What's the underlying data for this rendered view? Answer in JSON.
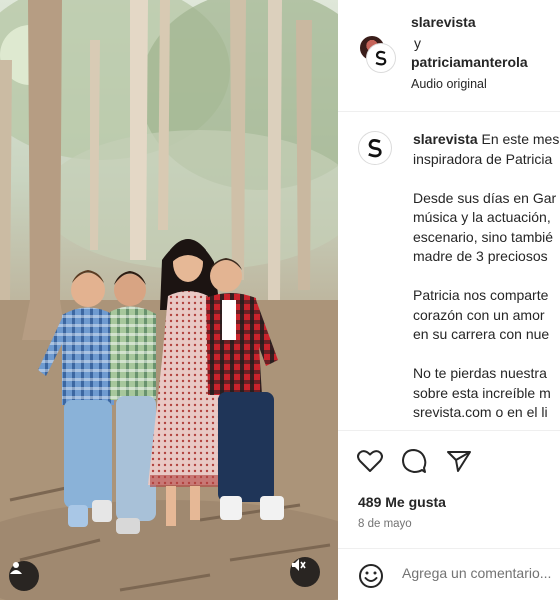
{
  "header": {
    "user1": "slarevista",
    "conjunction": "y",
    "user2": "patriciamanterola",
    "audio": "Audio original"
  },
  "caption": {
    "username": "slarevista",
    "text": " En este mes\ninspiradora de Patricia\n\nDesde sus días en Gar\nmúsica y la actuación,\nescenario, sino tambié\nmadre de 3 preciosos\n\nPatricia nos comparte\ncorazón con un amor\nen su carrera con nue\n\nNo te pierdas nuestra\nsobre esta increíble m\nsrevista.com o en el li"
  },
  "actions": {
    "like_icon": "heart-icon",
    "comment_icon": "comment-bubble-icon",
    "share_icon": "paper-plane-icon"
  },
  "likes": "489 Me gusta",
  "date": "8 de mayo",
  "comment": {
    "placeholder": "Agrega un comentario..."
  },
  "overlay": {
    "user_icon": "user-tags-icon",
    "mute_icon": "speaker-muted-icon"
  },
  "colors": {
    "text": "#262626",
    "secondary": "#737373",
    "divider": "#efefef"
  }
}
